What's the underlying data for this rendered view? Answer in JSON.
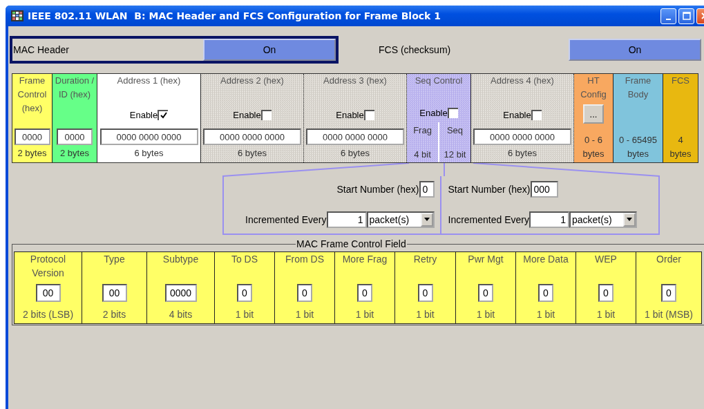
{
  "window": {
    "title": "IEEE 802.11 WLAN  B: MAC Header and FCS Configuration for Frame Block 1"
  },
  "mac_header": {
    "label": "MAC Header",
    "value": "On"
  },
  "fcs": {
    "label": "FCS (checksum)",
    "value": "On"
  },
  "fields": [
    {
      "kind": "input",
      "header": "Frame Control (hex)",
      "value": "0000",
      "size": [
        "2 bytes"
      ],
      "color": "#ffff66"
    },
    {
      "kind": "input",
      "header": "Duration / ID (hex)",
      "value": "0000",
      "size": [
        "2 bytes"
      ],
      "color": "#66ff88"
    },
    {
      "kind": "address",
      "header": "Address 1 (hex)",
      "enable": "Enable",
      "checked": true,
      "value": "0000 0000 0000",
      "size": [
        "6 bytes"
      ]
    },
    {
      "kind": "address",
      "header": "Address 2 (hex)",
      "enable": "Enable",
      "checked": false,
      "value": "0000 0000 0000",
      "size": [
        "6 bytes"
      ]
    },
    {
      "kind": "address",
      "header": "Address 3 (hex)",
      "enable": "Enable",
      "checked": false,
      "value": "0000 0000 0000",
      "size": [
        "6 bytes"
      ]
    },
    {
      "kind": "seq",
      "header": "Seq Control",
      "enable": "Enable",
      "checked": false,
      "parts": [
        {
          "label": "Frag",
          "size": "4 bit"
        },
        {
          "label": "Seq",
          "size": "12 bit"
        }
      ]
    },
    {
      "kind": "address",
      "header": "Address 4 (hex)",
      "enable": "Enable",
      "checked": false,
      "value": "0000 0000 0000",
      "size": [
        "6 bytes"
      ]
    },
    {
      "kind": "button",
      "header": "HT Config",
      "button": "...",
      "size": [
        "0 - 6",
        "bytes"
      ],
      "color": "#f8a860"
    },
    {
      "kind": "info",
      "header": "Frame Body",
      "size": [
        "0 - 65495",
        "bytes"
      ],
      "color": "#80c4dc"
    },
    {
      "kind": "info",
      "header": "FCS",
      "size": [
        "4",
        "bytes"
      ],
      "color": "#e8b810"
    }
  ],
  "sequence": [
    {
      "start_label": "Start Number (hex)",
      "start_value": "0",
      "increment_label": "Incremented Every",
      "increment_value": "1",
      "unit": "packet(s)"
    },
    {
      "start_label": "Start Number (hex)",
      "start_value": "000",
      "increment_label": "Incremented Every",
      "increment_value": "1",
      "unit": "packet(s)"
    }
  ],
  "frame_control": {
    "title": "MAC Frame Control Field",
    "bits": [
      {
        "name": "Protocol Version",
        "value": "00",
        "size": "2 bits (LSB)"
      },
      {
        "name": "Type",
        "value": "00",
        "size": "2 bits"
      },
      {
        "name": "Subtype",
        "value": "0000",
        "size": "4 bits"
      },
      {
        "name": "To DS",
        "value": "0",
        "size": "1 bit"
      },
      {
        "name": "From DS",
        "value": "0",
        "size": "1 bit"
      },
      {
        "name": "More Frag",
        "value": "0",
        "size": "1 bit"
      },
      {
        "name": "Retry",
        "value": "0",
        "size": "1 bit"
      },
      {
        "name": "Pwr Mgt",
        "value": "0",
        "size": "1 bit"
      },
      {
        "name": "More Data",
        "value": "0",
        "size": "1 bit"
      },
      {
        "name": "WEP",
        "value": "0",
        "size": "1 bit"
      },
      {
        "name": "Order",
        "value": "0",
        "size": "1 bit (MSB)"
      }
    ]
  }
}
